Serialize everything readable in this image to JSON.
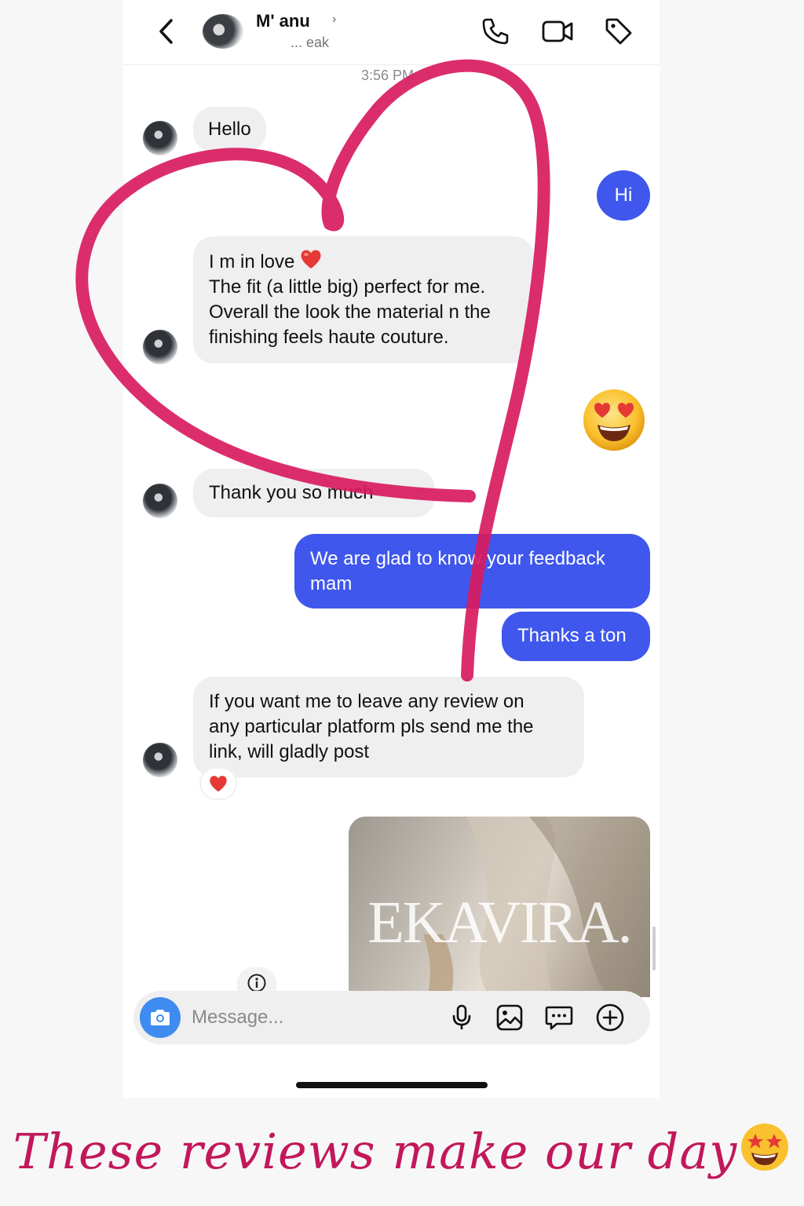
{
  "header": {
    "contact_name": "M' anu",
    "contact_chevron": "›",
    "contact_subtitle": "... eak",
    "icons": [
      "chevron-left-icon",
      "phone-icon",
      "video-camera-icon",
      "tag-icon"
    ]
  },
  "thread": {
    "timestamp": "3:56 PM",
    "messages": [
      {
        "from": "them",
        "lines": [
          "Hello"
        ]
      },
      {
        "from": "me",
        "lines": [
          "Hi"
        ]
      },
      {
        "from": "them",
        "lines": [
          "I m in love",
          "The fit (a little big) perfect for me.",
          "Overall the look the material n the",
          "finishing feels haute couture."
        ],
        "emoji": "red-heart"
      },
      {
        "from": "me",
        "type": "emoji",
        "emoji": "heart-eyes-face"
      },
      {
        "from": "them",
        "lines": [
          "Thank you so much"
        ]
      },
      {
        "from": "me",
        "lines": [
          "We are glad to know your feedback",
          "mam"
        ]
      },
      {
        "from": "me",
        "lines": [
          "Thanks a ton"
        ]
      },
      {
        "from": "them",
        "lines": [
          "If you want me to leave any review on",
          "any particular platform pls send me the",
          "link, will gladly post"
        ],
        "reaction": "red-heart"
      }
    ],
    "image_card": {
      "brand": "EKAVIRA."
    }
  },
  "composer": {
    "placeholder": "Message...",
    "icons": [
      "camera-icon",
      "microphone-icon",
      "gallery-icon",
      "sticker-icon",
      "plus-icon"
    ]
  },
  "caption": {
    "text": "These reviews make our day",
    "emoji": "star-struck-face",
    "color": "#c2185b"
  },
  "colors": {
    "outgoing_bubble": "#3f57ec",
    "incoming_bubble": "#efefef",
    "heart_stroke": "#d81b60"
  }
}
